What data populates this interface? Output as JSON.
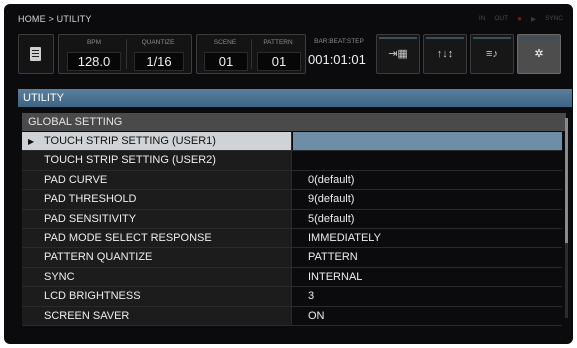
{
  "breadcrumb": "HOME > UTILITY",
  "status": {
    "in": "IN",
    "out": "OUT",
    "rec_dot": "●",
    "play": "▶",
    "sync": "SYNC"
  },
  "toolbar": {
    "bpm": {
      "label": "BPM",
      "value": "128.0"
    },
    "quantize": {
      "label": "QUANTIZE",
      "value": "1/16"
    },
    "scene": {
      "label": "SCENE",
      "value": "01"
    },
    "pattern": {
      "label": "PATTERN",
      "value": "01"
    },
    "bar_beat_step": {
      "label": "BAR:BEAT:STEP",
      "value": "001:01:01"
    },
    "modes": [
      {
        "icon": "sequencer-icon",
        "glyph": "⇥▦"
      },
      {
        "icon": "mixer-icon",
        "glyph": "↑↓↕"
      },
      {
        "icon": "sound-icon",
        "glyph": "≡♪"
      },
      {
        "icon": "settings-gear-icon",
        "glyph": "✲"
      }
    ]
  },
  "panel": {
    "title": "UTILITY",
    "section": "GLOBAL SETTING",
    "rows": [
      {
        "label": "TOUCH STRIP SETTING (USER1)",
        "value": "",
        "selected": true
      },
      {
        "label": "TOUCH STRIP SETTING (USER2)",
        "value": ""
      },
      {
        "label": "PAD CURVE",
        "value": "0(default)"
      },
      {
        "label": "PAD THRESHOLD",
        "value": "9(default)"
      },
      {
        "label": "PAD SENSITIVITY",
        "value": "5(default)"
      },
      {
        "label": "PAD MODE SELECT RESPONSE",
        "value": "IMMEDIATELY"
      },
      {
        "label": "PATTERN QUANTIZE",
        "value": "PATTERN"
      },
      {
        "label": "SYNC",
        "value": "INTERNAL"
      },
      {
        "label": "LCD BRIGHTNESS",
        "value": "3"
      },
      {
        "label": "SCREEN SAVER",
        "value": "ON"
      }
    ]
  },
  "colors": {
    "title_bar": "#4f7493",
    "selected_label": "#cfd3d6",
    "selected_value": "#6e8ea8"
  }
}
